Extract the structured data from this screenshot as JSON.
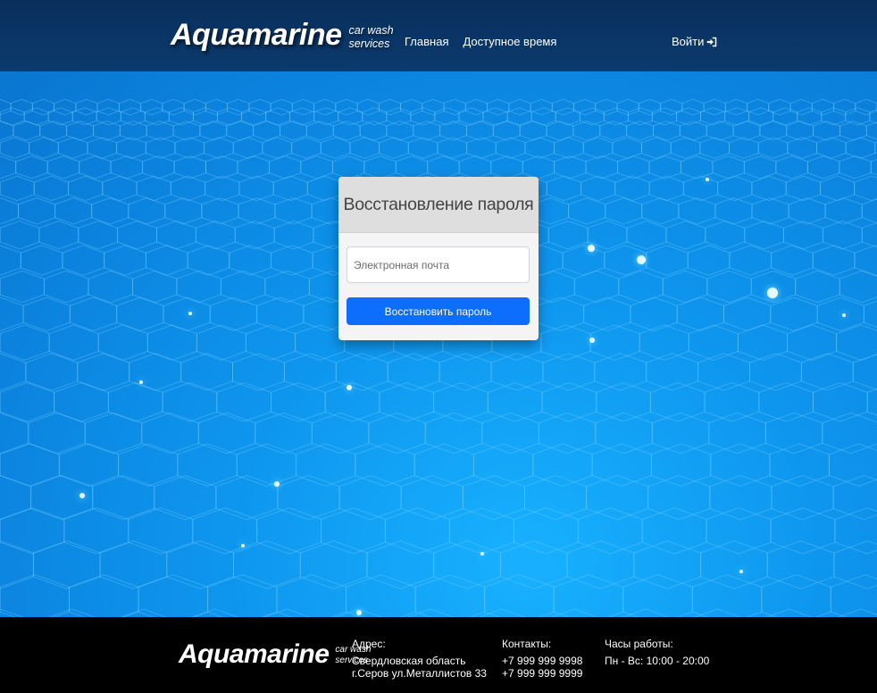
{
  "header": {
    "logo_main": "Aquamarine",
    "logo_sub_1": "car wash",
    "logo_sub_2": "services",
    "nav": [
      {
        "label": "Главная"
      },
      {
        "label": "Доступное время"
      }
    ],
    "login_label": "Войти",
    "login_icon": "sign-in-icon"
  },
  "card": {
    "title": "Восстановление пароля",
    "email_placeholder": "Электронная почта",
    "email_value": "",
    "submit_label": "Восстановить пароль"
  },
  "footer": {
    "logo_main": "Aquamarine",
    "logo_sub_1": "car wash",
    "logo_sub_2": "services",
    "address_label": "Адрес:",
    "address_line_1": "Свердловская область",
    "address_line_2": "г.Серов ул.Металлистов 33",
    "contacts_label": "Контакты:",
    "phone_1": "+7 999 999 9998",
    "phone_2": "+7 999 999 9999",
    "hours_label": "Часы работы:",
    "hours_value": "Пн - Вс: 10:00 - 20:00"
  },
  "colors": {
    "header_bg": "#0b3a6e",
    "hero_bg": "#0e96ee",
    "button_bg": "#0d6efd",
    "footer_bg": "#000000"
  }
}
